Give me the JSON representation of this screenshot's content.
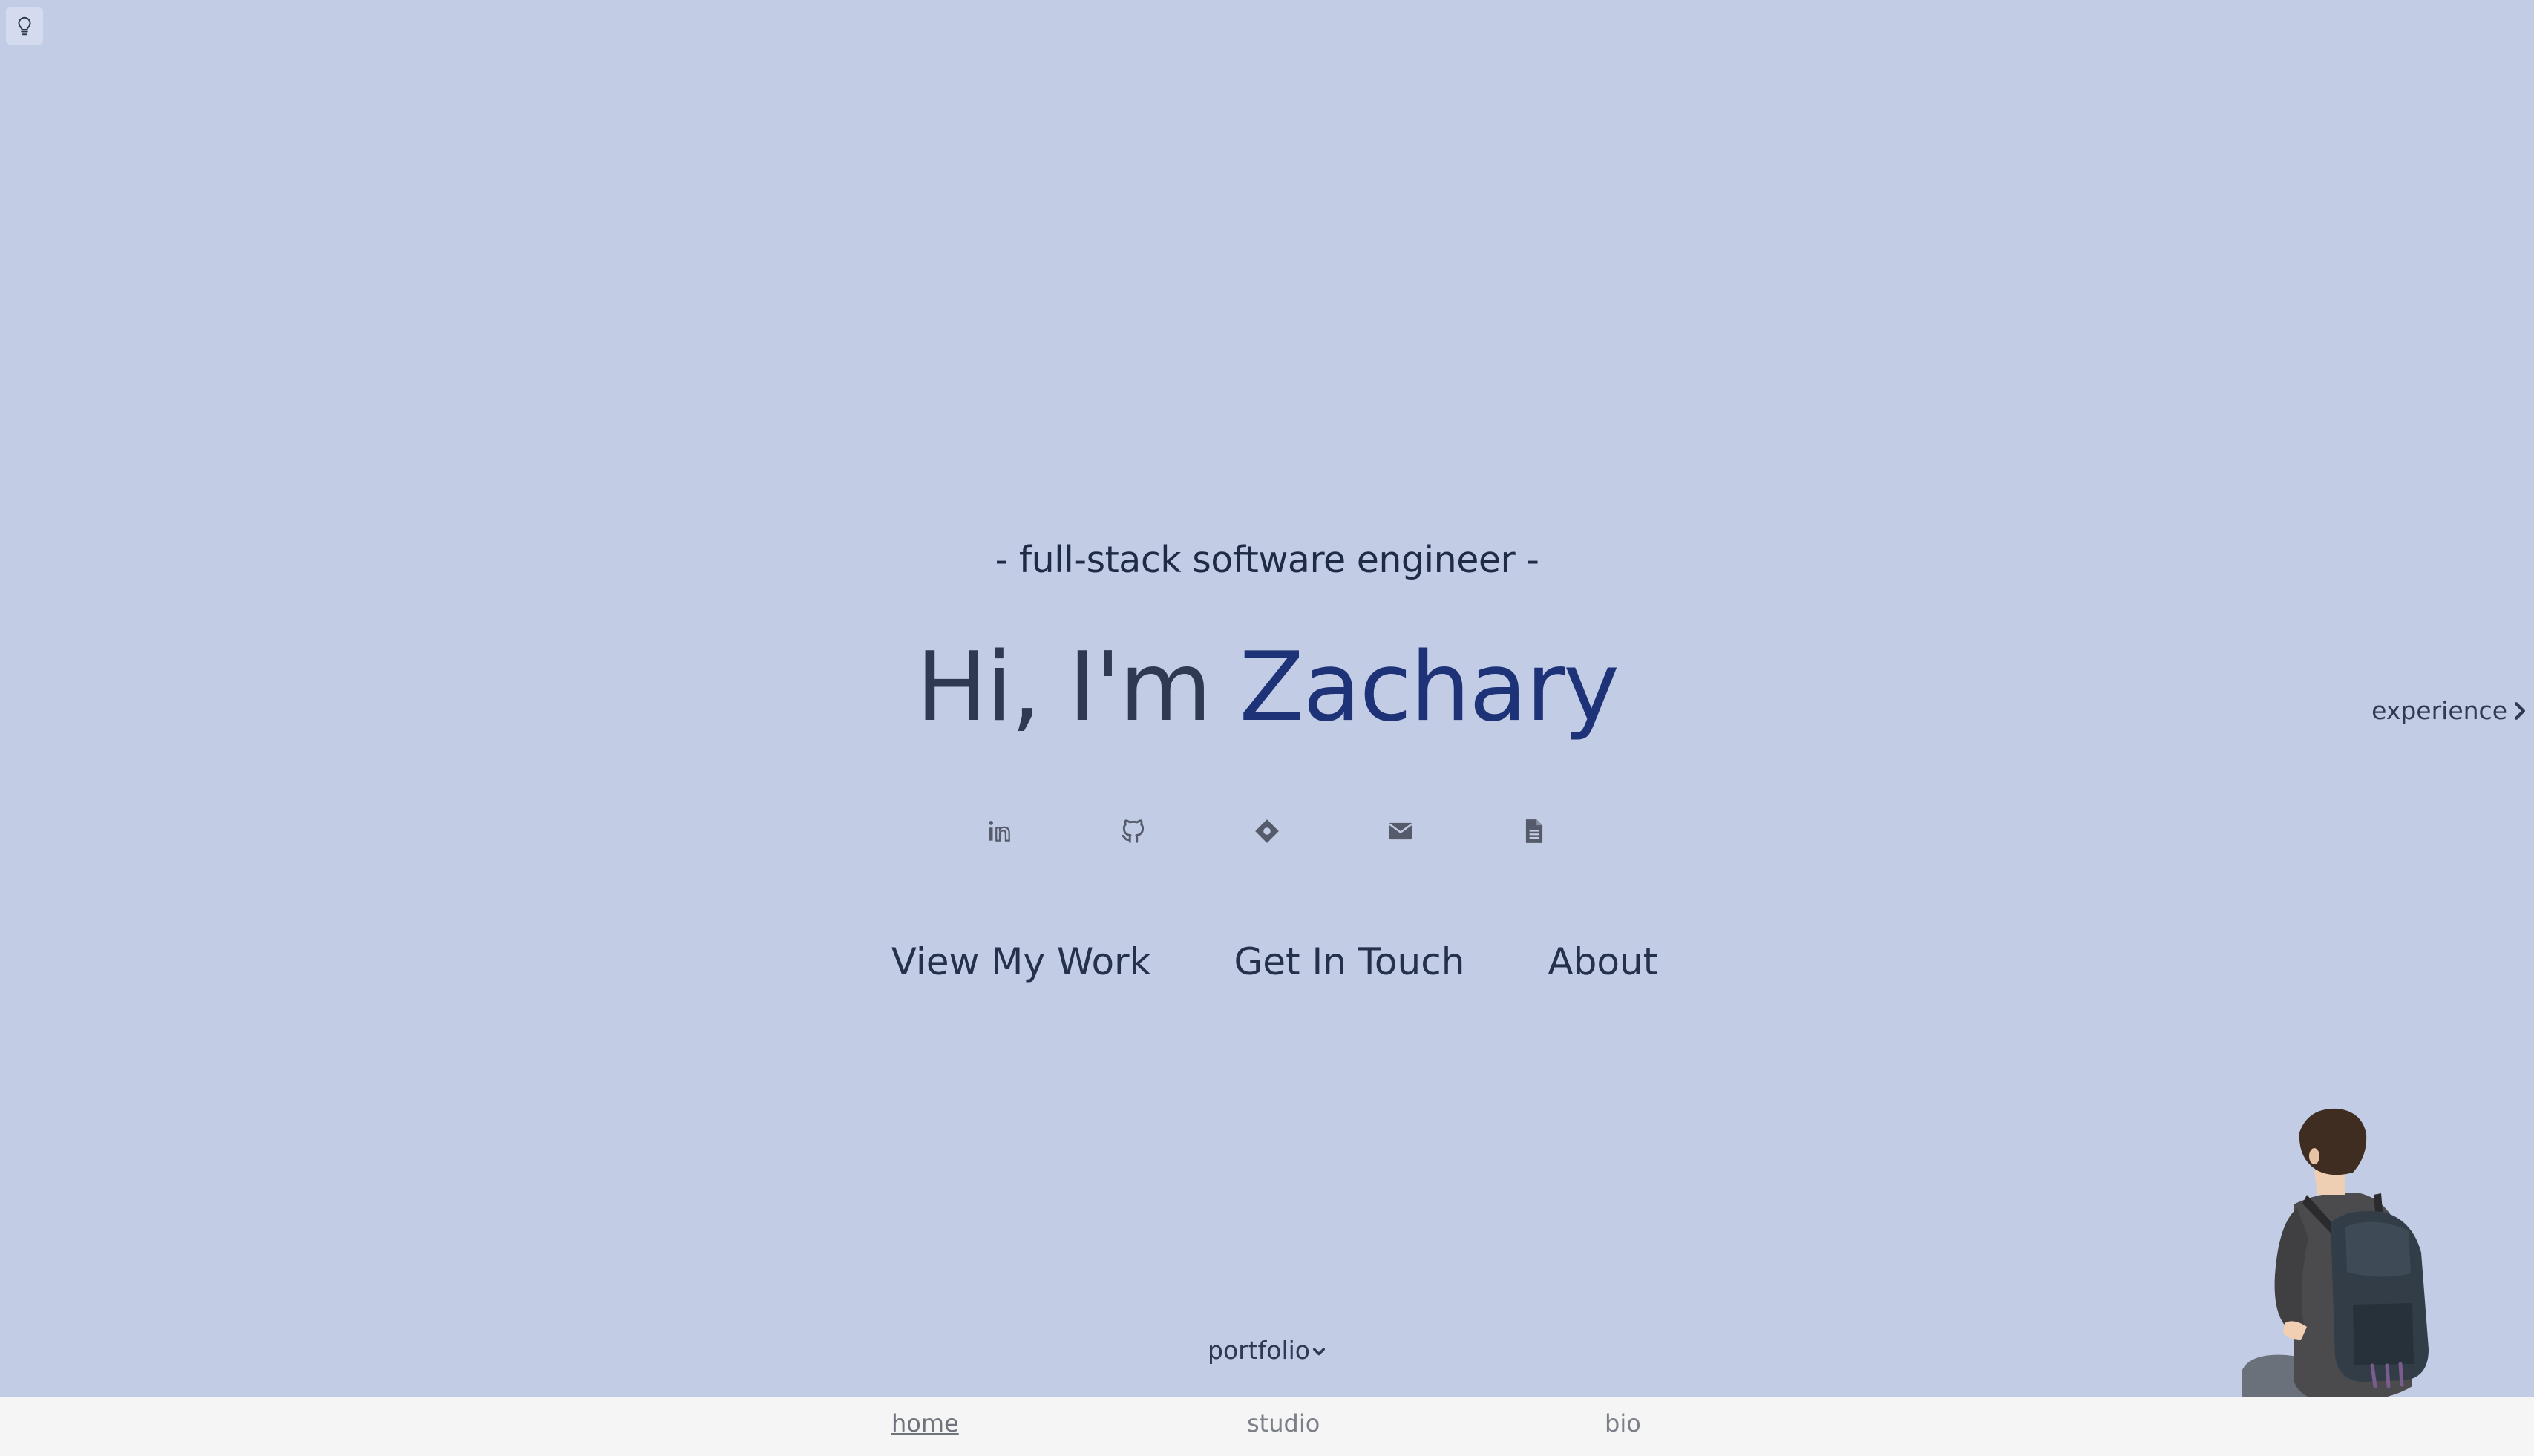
{
  "subtitle": "- full-stack software engineer -",
  "headline": {
    "greeting": "Hi, I'm ",
    "name": "Zachary"
  },
  "socials": [
    {
      "icon": "linkedin-icon"
    },
    {
      "icon": "github-icon"
    },
    {
      "icon": "diamond-icon"
    },
    {
      "icon": "mail-icon"
    },
    {
      "icon": "document-icon"
    }
  ],
  "ctas": {
    "work": "View My Work",
    "contact": "Get In Touch",
    "about": "About"
  },
  "side_link": {
    "label": "experience",
    "icon": "chevron-right-icon"
  },
  "portfolio": {
    "label": "portfolio",
    "icon": "chevron-down-icon"
  },
  "footer_nav": {
    "home": "home",
    "studio": "studio",
    "bio": "bio"
  },
  "colors": {
    "background": "#c3cce5",
    "name_accent": "#1e3278",
    "text": "#2f3a52",
    "footer": "#f5f5f5"
  },
  "top_left_icon": "lightbulb-icon"
}
